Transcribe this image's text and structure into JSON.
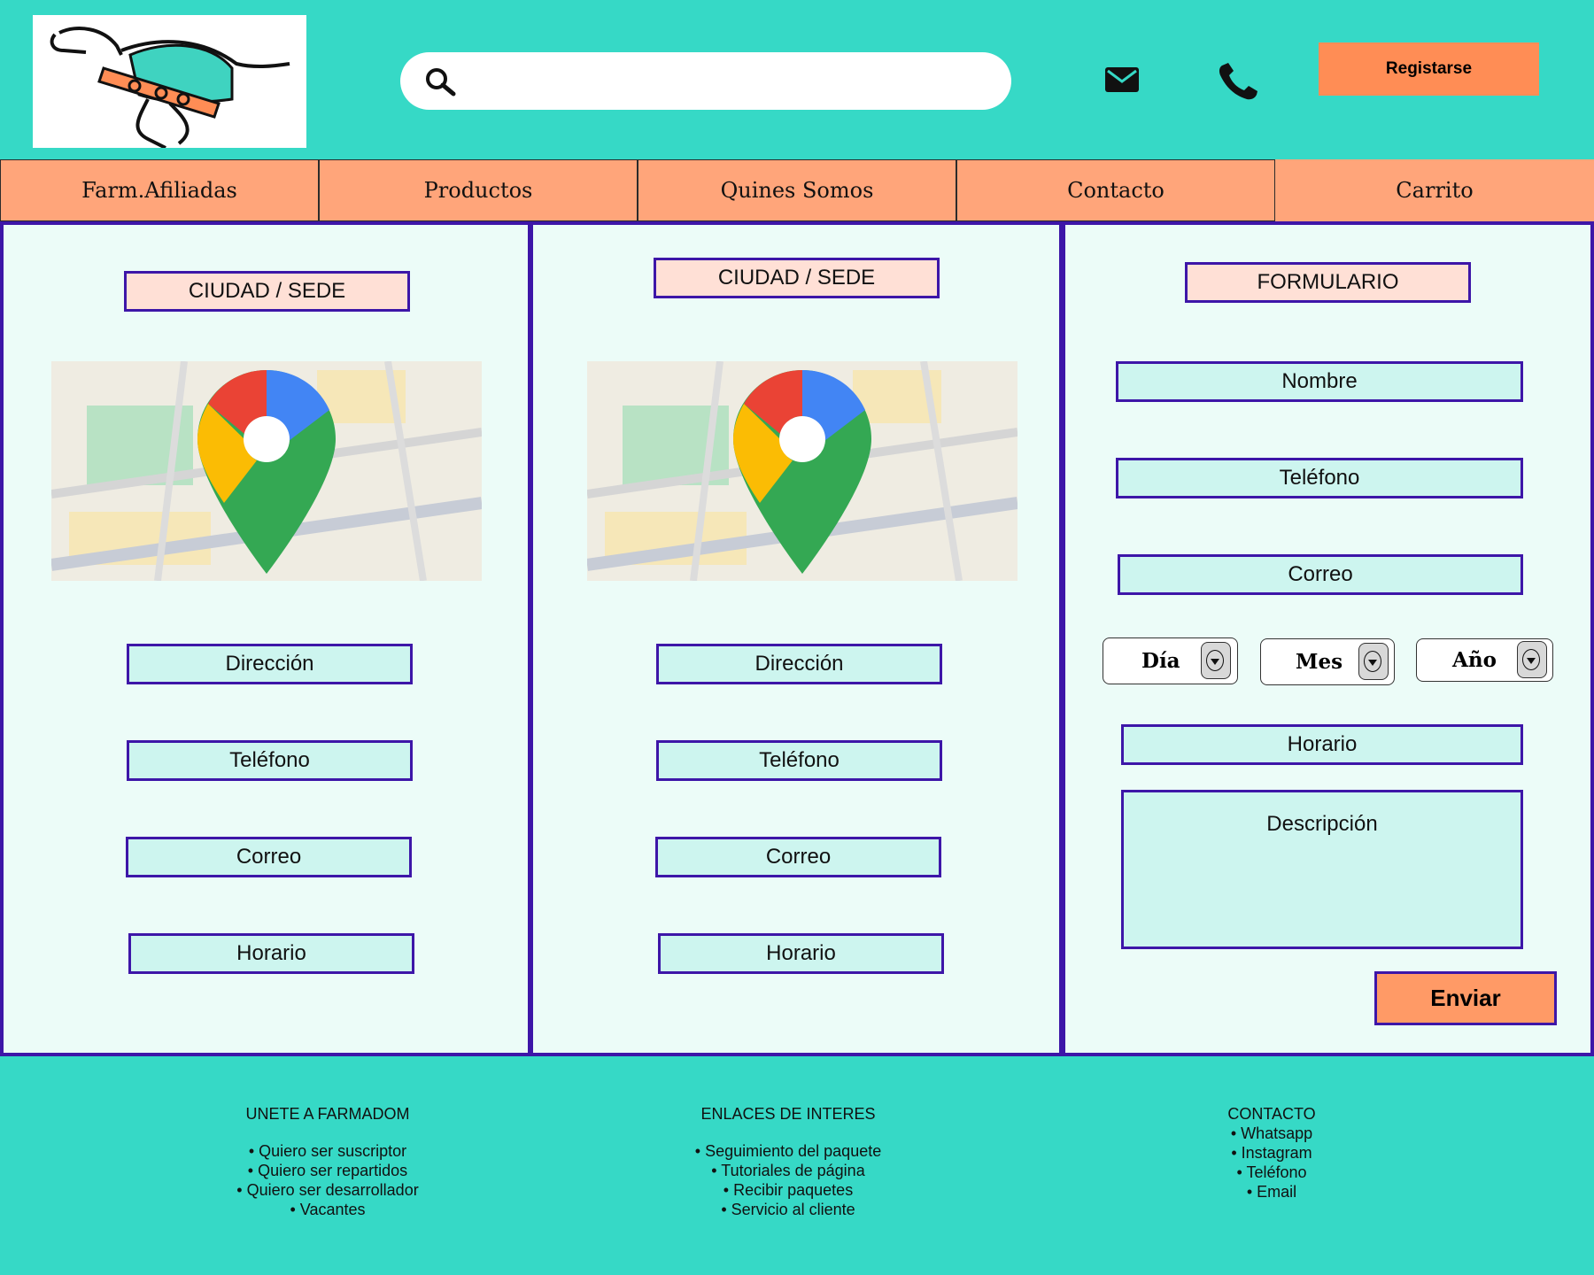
{
  "header": {
    "search_placeholder": "",
    "register_label": "Registarse"
  },
  "nav": {
    "items": [
      "Farm.Afiliadas",
      "Productos",
      "Quines Somos",
      "Contacto",
      "Carrito"
    ]
  },
  "sede1": {
    "title": "CIUDAD / SEDE",
    "direccion": "Dirección",
    "telefono": "Teléfono",
    "correo": "Correo",
    "horario": "Horario"
  },
  "sede2": {
    "title": "CIUDAD / SEDE",
    "direccion": "Dirección",
    "telefono": "Teléfono",
    "correo": "Correo",
    "horario": "Horario"
  },
  "form": {
    "title": "FORMULARIO",
    "nombre": "Nombre",
    "telefono": "Teléfono",
    "correo": "Correo",
    "dia": "Día",
    "mes": "Mes",
    "anio": "Año",
    "horario": "Horario",
    "descripcion": "Descripción",
    "send_label": "Enviar"
  },
  "footer": {
    "join": {
      "title": "UNETE A FARMADOM",
      "items": [
        "Quiero ser suscriptor",
        "Quiero ser repartidos",
        "Quiero ser desarrollador",
        "Vacantes"
      ]
    },
    "links": {
      "title": "ENLACES DE INTERES",
      "items": [
        "Seguimiento del paquete",
        "Tutoriales de página",
        "Recibir paquetes",
        "Servicio al cliente"
      ]
    },
    "contact": {
      "title": "CONTACTO",
      "items": [
        "Whatsapp",
        "Instagram",
        "Teléfono",
        "Email"
      ]
    }
  },
  "colors": {
    "background": "#36d9c6",
    "accent": "#ff8d55",
    "nav": "#ffa57a",
    "border": "#3d16a8",
    "field": "#cdf5ef"
  },
  "icons": [
    "dog-logo",
    "search-icon",
    "mail-icon",
    "phone-icon",
    "map-pin-icon"
  ]
}
